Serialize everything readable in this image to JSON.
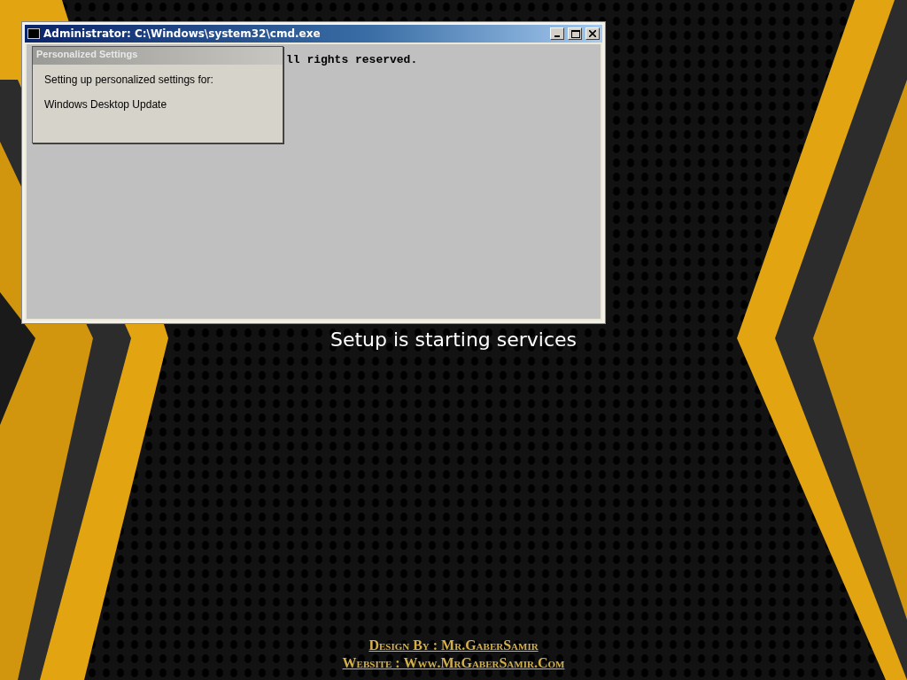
{
  "console_window": {
    "title": "Administrator: C:\\Windows\\system32\\cmd.exe",
    "lines": [
      "ll rights reserved."
    ]
  },
  "dialog": {
    "title": "Personalized Settings",
    "lines": [
      "Setting up personalized settings for:",
      "Windows Desktop Update"
    ]
  },
  "status": "Setup is starting services",
  "credits": [
    "Design By : Mr.GaberSamir",
    "Website : Www.MrGaberSamir.Com"
  ]
}
